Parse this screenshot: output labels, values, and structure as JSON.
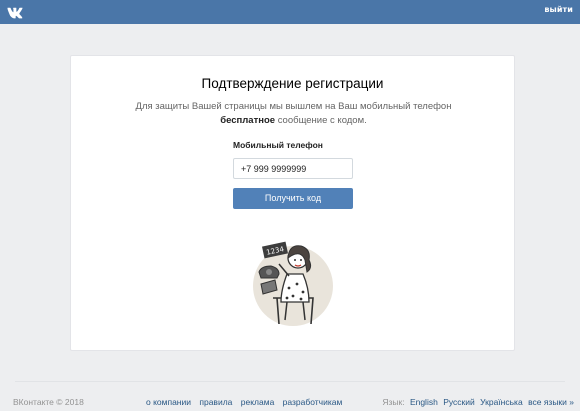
{
  "header": {
    "logo_icon": "vk-logo-icon",
    "logout_label": "выйти",
    "bg_color": "#4a76a8"
  },
  "card": {
    "title": "Подтверждение регистрации",
    "desc_part1": "Для защиты Вашей страницы мы вышлем на Ваш мобильный телефон ",
    "desc_bold": "бесплатное",
    "desc_part2": " сообщение с кодом.",
    "phone_label": "Мобильный телефон",
    "phone_value": "+7 999 9999999",
    "submit_label": "Получить код",
    "illustration_sign": "1234",
    "button_color": "#5181b8"
  },
  "footer": {
    "copyright": "ВКонтакте © 2018",
    "links": [
      "о компании",
      "правила",
      "реклама",
      "разработчикам"
    ],
    "lang_label": "Язык:",
    "languages": [
      "English",
      "Русский",
      "Українська",
      "все языки »"
    ]
  }
}
